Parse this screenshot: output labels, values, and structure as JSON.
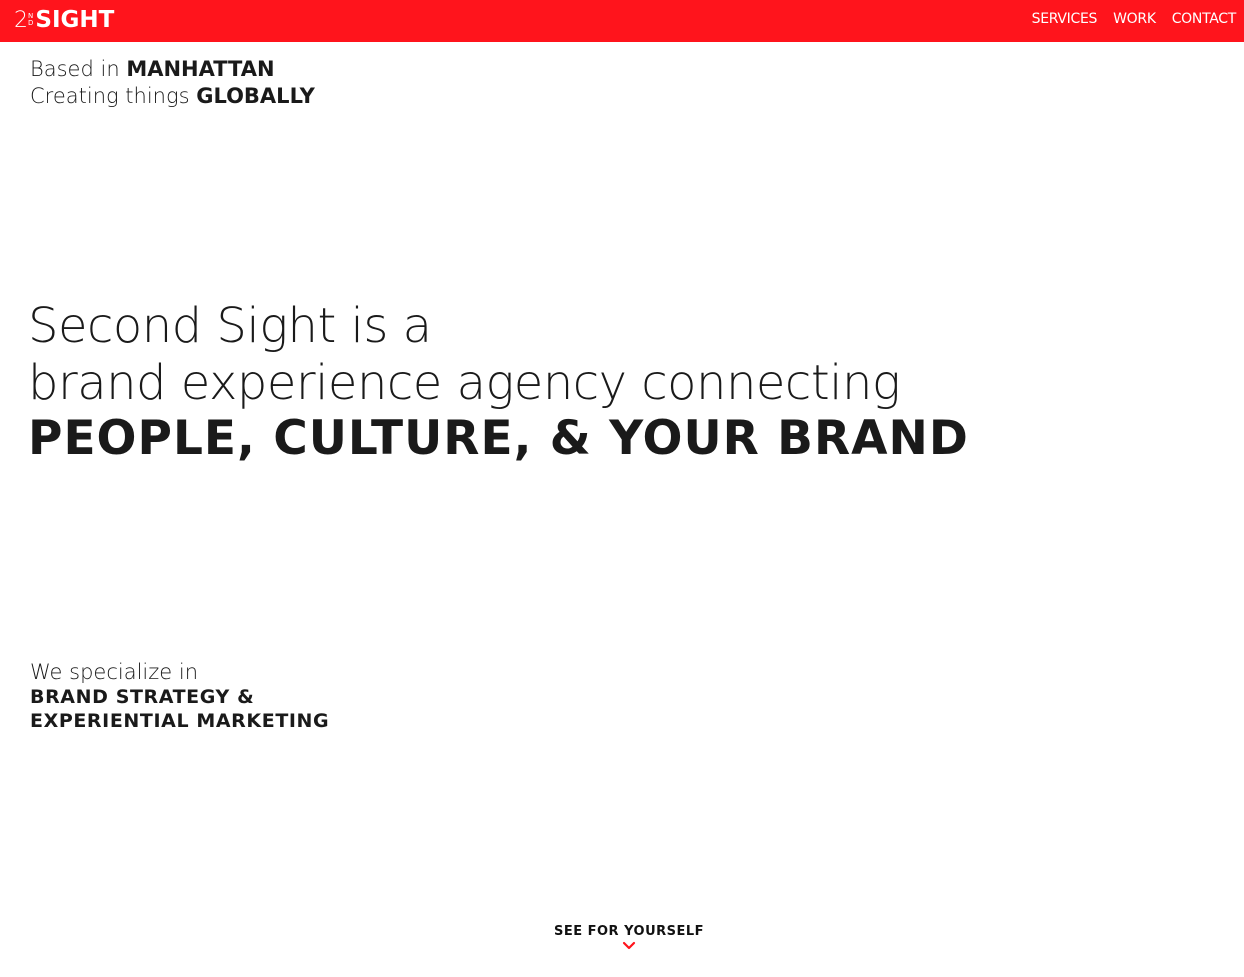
{
  "header": {
    "logo_num": "2",
    "logo_sup": "N",
    "logo_sub": "D",
    "logo_word": "SIGHT",
    "nav": [
      "SERVICES",
      "WORK",
      "CONTACT"
    ],
    "accent_color": "#ff141c"
  },
  "intro": {
    "based_prefix": "Based in",
    "based_city": "MANHATTAN",
    "creating_prefix": "Creating things",
    "creating_scope": "GLOBALLY"
  },
  "hero": {
    "line1": "Second Sight is a",
    "line2": "brand experience agency connecting",
    "line3": "PEOPLE, CULTURE, & YOUR BRAND"
  },
  "specialize": {
    "intro": "We specialize in",
    "line1": "BRAND STRATEGY &",
    "line2": "EXPERIENTIAL MARKETING"
  },
  "cta": {
    "label": "SEE FOR YOURSELF",
    "icon": "chevron-down-icon"
  }
}
